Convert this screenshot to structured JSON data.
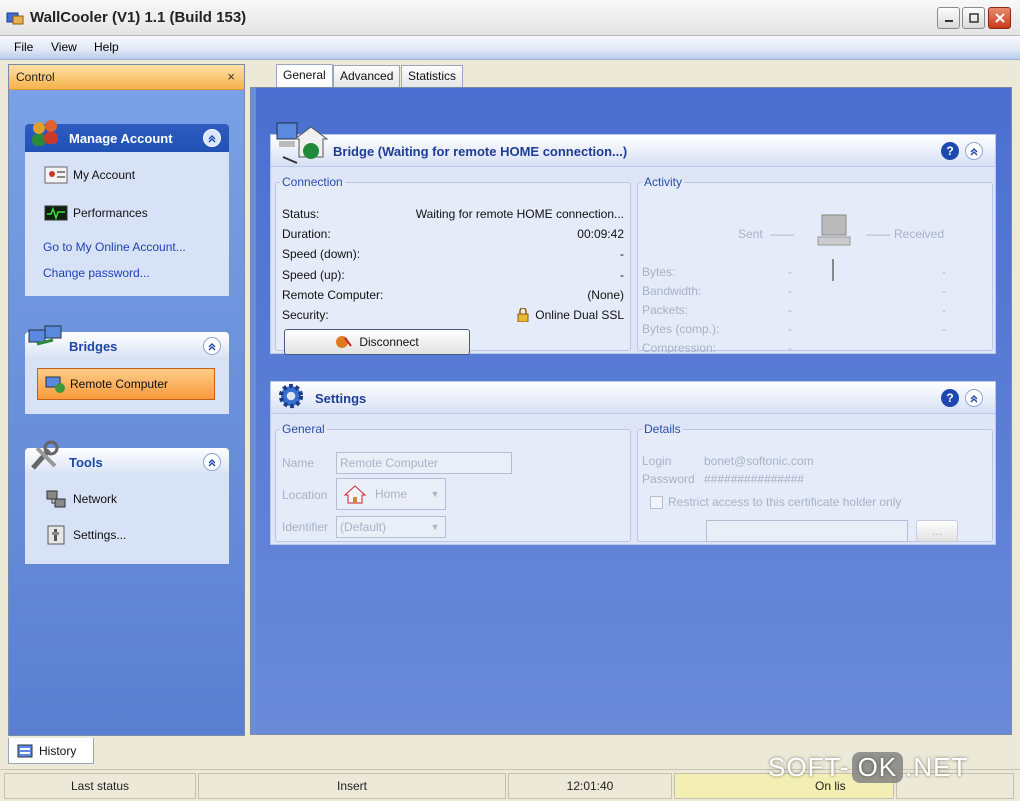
{
  "window": {
    "title": "WallCooler (V1) 1.1 (Build 153)"
  },
  "menu": [
    "File",
    "View",
    "Help"
  ],
  "control": {
    "title": "Control",
    "close": "×",
    "manage": {
      "title": "Manage Account",
      "items": [
        "My Account",
        "Performances"
      ],
      "links": [
        "Go to My Online Account...",
        "Change password..."
      ]
    },
    "bridges": {
      "title": "Bridges",
      "selected": "Remote Computer"
    },
    "tools": {
      "title": "Tools",
      "items": [
        "Network",
        "Settings..."
      ]
    }
  },
  "tabs": [
    "General",
    "Advanced",
    "Statistics"
  ],
  "bridge_panel": {
    "title": "Bridge (Waiting for remote HOME connection...)",
    "connection": {
      "legend": "Connection",
      "rows": [
        {
          "label": "Status:",
          "value": "Waiting for remote HOME connection..."
        },
        {
          "label": "Duration:",
          "value": "00:09:42"
        },
        {
          "label": "Speed (down):",
          "value": "-"
        },
        {
          "label": "Speed (up):",
          "value": "-"
        },
        {
          "label": "Remote Computer:",
          "value": "(None)"
        },
        {
          "label": "Security:",
          "value": "Online Dual SSL"
        }
      ],
      "button": "Disconnect"
    },
    "activity": {
      "legend": "Activity",
      "sent": "Sent",
      "received": "Received",
      "rows": [
        "Bytes:",
        "Bandwidth:",
        "Packets:",
        "Bytes (comp.):",
        "Compression:"
      ],
      "dash": "-"
    }
  },
  "settings_panel": {
    "title": "Settings",
    "general": {
      "legend": "General",
      "name_label": "Name",
      "name_value": "Remote Computer",
      "location_label": "Location",
      "location_value": "Home",
      "identifier_label": "Identifier",
      "identifier_value": "(Default)"
    },
    "details": {
      "legend": "Details",
      "login_label": "Login",
      "login_value": "bonet@softonic.com",
      "password_label": "Password",
      "password_value": "###############",
      "restrict_label": "Restrict access to this certificate holder only",
      "browse": "..."
    }
  },
  "history_tab": "History",
  "status": {
    "last_status": "Last status",
    "mode": "Insert",
    "time": "12:01:40",
    "extra": "On lis"
  },
  "watermark": {
    "left": "SOFT-",
    "ok": "OK",
    "right": ".NET"
  },
  "colors": {
    "accent": "#2052b4",
    "panel": "#dde5f6",
    "selected": "#f79a3a"
  }
}
